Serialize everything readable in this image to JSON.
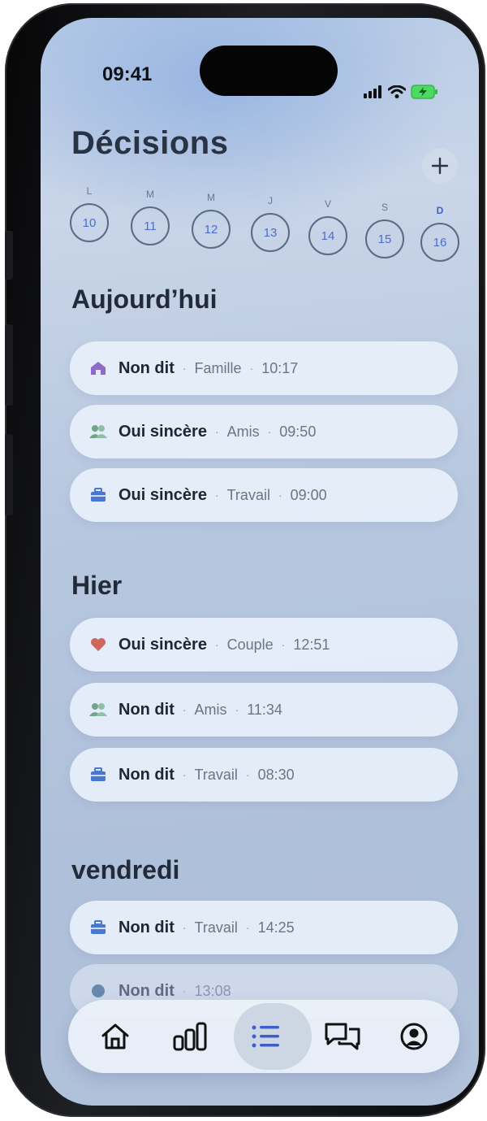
{
  "status_bar": {
    "time": "09:41"
  },
  "header": {
    "title": "Décisions"
  },
  "week": [
    {
      "label": "L",
      "day": "10",
      "active": false
    },
    {
      "label": "M",
      "day": "11",
      "active": false
    },
    {
      "label": "M",
      "day": "12",
      "active": false
    },
    {
      "label": "J",
      "day": "13",
      "active": false
    },
    {
      "label": "V",
      "day": "14",
      "active": false
    },
    {
      "label": "S",
      "day": "15",
      "active": false
    },
    {
      "label": "D",
      "day": "16",
      "active": true
    }
  ],
  "sections": [
    {
      "title": "Aujourd’hui",
      "items": [
        {
          "icon": "house-icon",
          "title": "Non dit",
          "category": "Famille",
          "time": "10:17"
        },
        {
          "icon": "people-icon",
          "title": "Oui sincère",
          "category": "Amis",
          "time": "09:50"
        },
        {
          "icon": "briefcase-icon",
          "title": "Oui sincère",
          "category": "Travail",
          "time": "09:00"
        }
      ]
    },
    {
      "title": "Hier",
      "items": [
        {
          "icon": "heart-icon",
          "title": "Oui sincère",
          "category": "Couple",
          "time": "12:51"
        },
        {
          "icon": "people-icon",
          "title": "Non dit",
          "category": "Amis",
          "time": "11:34"
        },
        {
          "icon": "briefcase-icon",
          "title": "Non dit",
          "category": "Travail",
          "time": "08:30"
        }
      ]
    },
    {
      "title": "vendredi",
      "items": [
        {
          "icon": "briefcase-icon",
          "title": "Non dit",
          "category": "Travail",
          "time": "14:25"
        },
        {
          "icon": "dot-icon",
          "title": "Non dit",
          "category": "",
          "time": "13:08"
        }
      ]
    }
  ],
  "tabbar": {
    "tabs": [
      "home-icon",
      "stats-icon",
      "list-icon",
      "chat-icon",
      "profile-icon"
    ],
    "active": "list-icon"
  },
  "colors": {
    "accent": "#3f5fc8",
    "house": "#8d6bc7",
    "people": "#6fa58c",
    "briefcase": "#4a78d0",
    "heart": "#d0655a"
  }
}
